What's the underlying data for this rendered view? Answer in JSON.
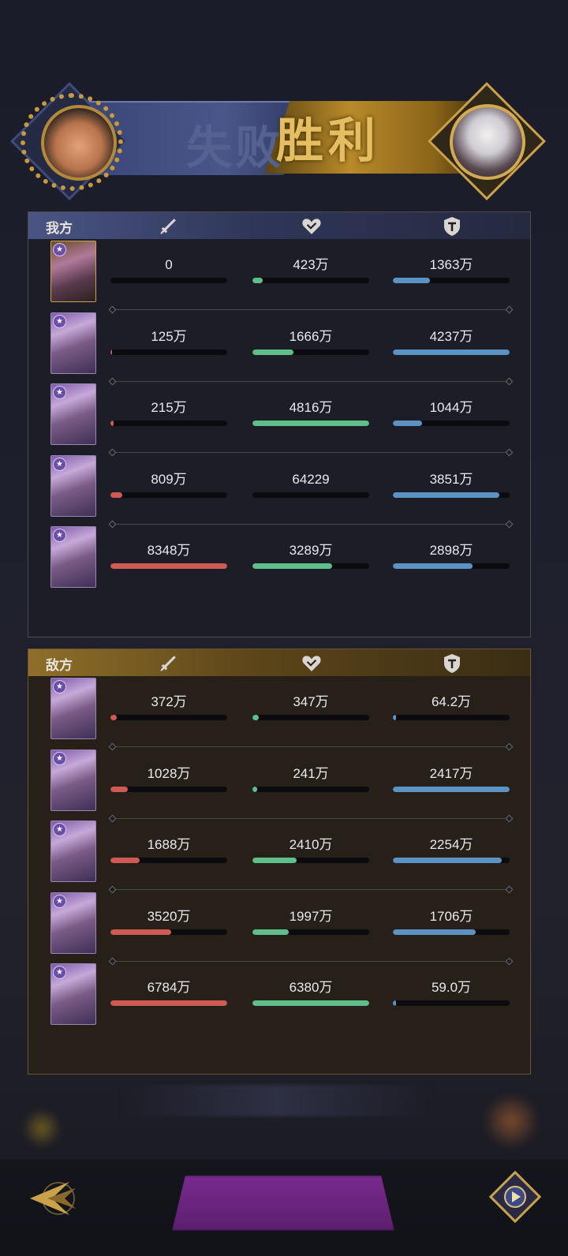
{
  "banner": {
    "lose_label": "失败",
    "win_label": "胜利",
    "left_avatar": "player-avatar",
    "right_avatar": "enemy-avatar"
  },
  "columns": {
    "attack_icon": "sword-icon",
    "heal_icon": "heart-icon",
    "defense_icon": "shield-icon"
  },
  "our_side": {
    "label": "我方",
    "rows": [
      {
        "attack": "0",
        "attack_pct": 0,
        "heal": "423万",
        "heal_pct": 9,
        "defense": "1363万",
        "defense_pct": 32
      },
      {
        "attack": "125万",
        "attack_pct": 1.5,
        "heal": "1666万",
        "heal_pct": 35,
        "defense": "4237万",
        "defense_pct": 100
      },
      {
        "attack": "215万",
        "attack_pct": 2.5,
        "heal": "4816万",
        "heal_pct": 100,
        "defense": "1044万",
        "defense_pct": 25
      },
      {
        "attack": "809万",
        "attack_pct": 10,
        "heal": "64229",
        "heal_pct": 0,
        "defense": "3851万",
        "defense_pct": 91
      },
      {
        "attack": "8348万",
        "attack_pct": 100,
        "heal": "3289万",
        "heal_pct": 68,
        "defense": "2898万",
        "defense_pct": 68
      }
    ]
  },
  "enemy_side": {
    "label": "敌方",
    "rows": [
      {
        "attack": "372万",
        "attack_pct": 5.5,
        "heal": "347万",
        "heal_pct": 5.5,
        "defense": "64.2万",
        "defense_pct": 2.5
      },
      {
        "attack": "1028万",
        "attack_pct": 15,
        "heal": "241万",
        "heal_pct": 4,
        "defense": "2417万",
        "defense_pct": 100
      },
      {
        "attack": "1688万",
        "attack_pct": 25,
        "heal": "2410万",
        "heal_pct": 38,
        "defense": "2254万",
        "defense_pct": 93
      },
      {
        "attack": "3520万",
        "attack_pct": 52,
        "heal": "1997万",
        "heal_pct": 31,
        "defense": "1706万",
        "defense_pct": 71
      },
      {
        "attack": "6784万",
        "attack_pct": 100,
        "heal": "6380万",
        "heal_pct": 100,
        "defense": "59.0万",
        "defense_pct": 2.5
      }
    ]
  },
  "colors": {
    "attack": "#cf5a55",
    "heal": "#5fbf8a",
    "defense": "#5b93c4"
  }
}
